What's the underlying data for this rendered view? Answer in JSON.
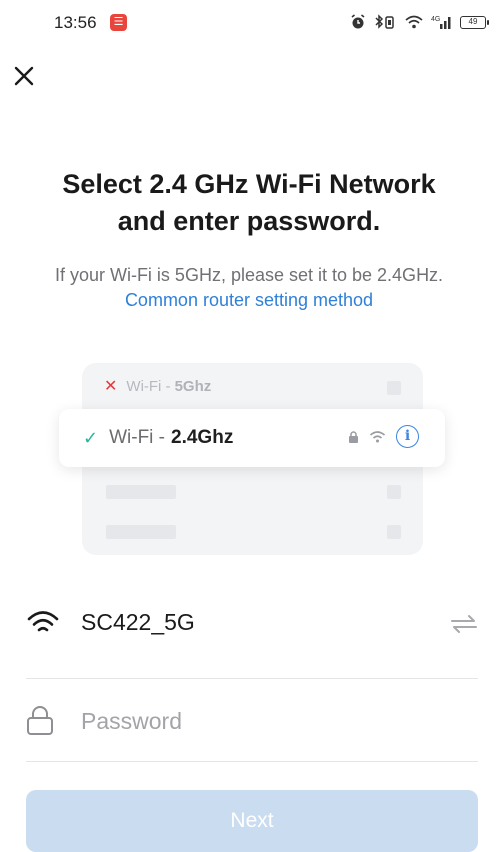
{
  "status_bar": {
    "time": "13:56",
    "notification_badge": "☰",
    "battery": "49",
    "icons": [
      "alarm-icon",
      "bluetooth-vibrate-icon",
      "wifi-icon",
      "signal-icon",
      "battery-icon"
    ]
  },
  "header": {
    "close_icon": "close-icon"
  },
  "title": {
    "line1": "Select 2.4 GHz Wi-Fi Network",
    "line2": "and enter password."
  },
  "subtitle": {
    "text": "If your Wi-Fi is 5GHz, please set it to be 2.4GHz. ",
    "link": "Common router setting method"
  },
  "illustration": {
    "bad": {
      "prefix": "Wi-Fi - ",
      "band": "5Ghz"
    },
    "good": {
      "prefix": "Wi-Fi - ",
      "band": "2.4Ghz"
    }
  },
  "form": {
    "ssid": "SC422_5G",
    "password_placeholder": "Password",
    "next_label": "Next"
  },
  "colors": {
    "accent": "#2f80d8",
    "button_disabled": "#c9dcf0",
    "check": "#2ab49a",
    "error": "#e23b3b"
  }
}
